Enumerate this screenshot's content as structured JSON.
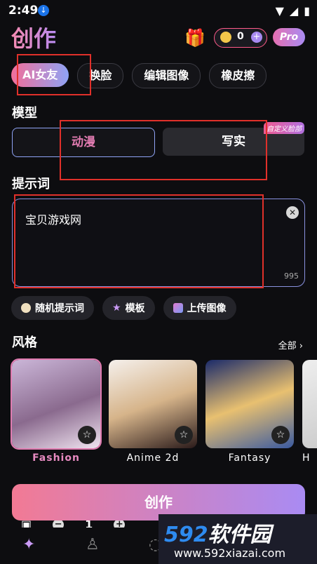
{
  "status": {
    "time": "2:49"
  },
  "header": {
    "title": "创作",
    "coins": "0",
    "pro_label": "Pro"
  },
  "tabs": [
    "AI女友",
    "换脸",
    "编辑图像",
    "橡皮擦"
  ],
  "model": {
    "label": "模型",
    "option_anime": "动漫",
    "option_real": "写实",
    "badge": "自定义脸部"
  },
  "prompt": {
    "label": "提示词",
    "value": "宝贝游戏网",
    "count": "995"
  },
  "chips": {
    "random": "随机提示词",
    "template": "模板",
    "upload": "上传图像"
  },
  "style": {
    "label": "风格",
    "all": "全部 ›",
    "cards": [
      {
        "name": "Fashion"
      },
      {
        "name": "Anime 2d"
      },
      {
        "name": "Fantasy"
      },
      {
        "name": "H"
      }
    ]
  },
  "stepper": {
    "count": "1"
  },
  "create_label": "创作",
  "watermark": {
    "line1_a": "592",
    "line1_b": "软件园",
    "line2": "www.592xiazai.com"
  },
  "colors": {
    "accent_pink": "#f26e9a",
    "accent_purple": "#a98bf3"
  }
}
